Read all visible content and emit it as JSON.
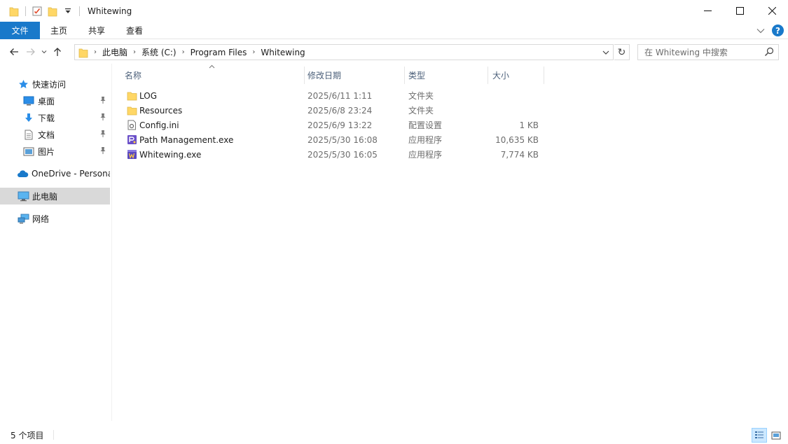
{
  "window": {
    "title": "Whitewing"
  },
  "ribbon": {
    "tabs": [
      "文件",
      "主页",
      "共享",
      "查看"
    ]
  },
  "address": {
    "crumbs": [
      "此电脑",
      "系统 (C:)",
      "Program Files",
      "Whitewing"
    ]
  },
  "search": {
    "placeholder": "在 Whitewing 中搜索"
  },
  "nav": {
    "quick_access": "快速访问",
    "desktop": "桌面",
    "downloads": "下载",
    "documents": "文档",
    "pictures": "图片",
    "onedrive": "OneDrive - Personal",
    "this_pc": "此电脑",
    "network": "网络"
  },
  "columns": {
    "name": "名称",
    "date": "修改日期",
    "type": "类型",
    "size": "大小"
  },
  "files": [
    {
      "name": "LOG",
      "date": "2025/6/11 1:11",
      "type": "文件夹",
      "size": "",
      "icon": "folder-icon"
    },
    {
      "name": "Resources",
      "date": "2025/6/8 23:24",
      "type": "文件夹",
      "size": "",
      "icon": "folder-icon"
    },
    {
      "name": "Config.ini",
      "date": "2025/6/9 13:22",
      "type": "配置设置",
      "size": "1 KB",
      "icon": "ini-file-icon"
    },
    {
      "name": "Path Management.exe",
      "date": "2025/5/30 16:08",
      "type": "应用程序",
      "size": "10,635 KB",
      "icon": "app-icon"
    },
    {
      "name": "Whitewing.exe",
      "date": "2025/5/30 16:05",
      "type": "应用程序",
      "size": "7,774 KB",
      "icon": "app-icon"
    }
  ],
  "status": {
    "count": "5 个项目"
  },
  "colors": {
    "accent": "#1979ca",
    "selected_nav": "#d9d9d9",
    "folder": "#ffd766"
  }
}
